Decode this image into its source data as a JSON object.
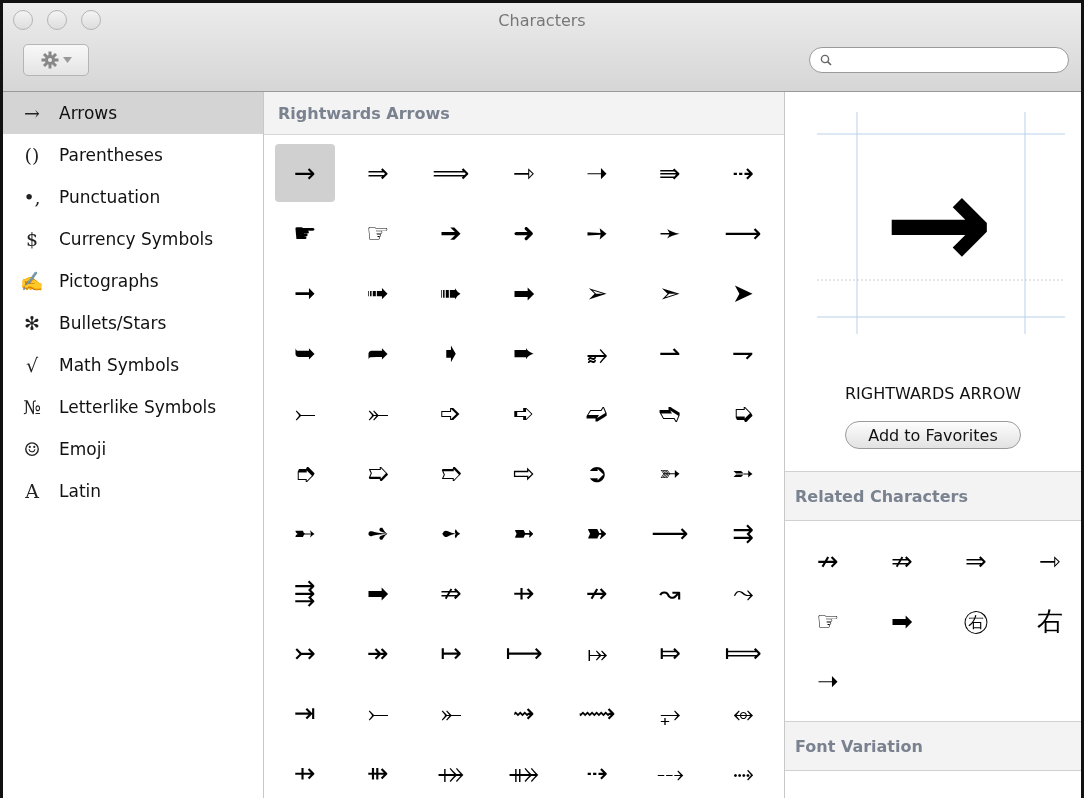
{
  "window": {
    "title": "Characters"
  },
  "sidebar": {
    "items": [
      {
        "symbol": "→",
        "label": "Arrows",
        "selected": true
      },
      {
        "symbol": "()",
        "label": "Parentheses",
        "selected": false
      },
      {
        "symbol": "•,",
        "label": "Punctuation",
        "selected": false
      },
      {
        "symbol": "$",
        "label": "Currency Symbols",
        "selected": false
      },
      {
        "symbol": "✍",
        "label": "Pictographs",
        "selected": false
      },
      {
        "symbol": "✻",
        "label": "Bullets/Stars",
        "selected": false
      },
      {
        "symbol": "√",
        "label": "Math Symbols",
        "selected": false
      },
      {
        "symbol": "№",
        "label": "Letterlike Symbols",
        "selected": false
      },
      {
        "symbol": "☺",
        "label": "Emoji",
        "selected": false
      },
      {
        "symbol": "A",
        "label": "Latin",
        "selected": false
      }
    ]
  },
  "grid": {
    "title": "Rightwards Arrows",
    "rows": [
      [
        {
          "char": "→",
          "selected": true
        },
        {
          "char": "⇒",
          "selected": false
        },
        {
          "char": "⟹",
          "selected": false
        },
        {
          "char": "⇾",
          "selected": false
        },
        {
          "char": "➝",
          "selected": false
        },
        {
          "char": "⇛",
          "selected": false
        },
        {
          "char": "⇢",
          "selected": false
        }
      ],
      [
        {
          "char": "☛",
          "selected": false
        },
        {
          "char": "☞",
          "selected": false
        },
        {
          "char": "➔",
          "selected": false
        },
        {
          "char": "➜",
          "selected": false
        },
        {
          "char": "➙",
          "selected": false
        },
        {
          "char": "➛",
          "selected": false
        },
        {
          "char": "⟶",
          "selected": false
        }
      ],
      [
        {
          "char": "➞",
          "selected": false
        },
        {
          "char": "➟",
          "selected": false
        },
        {
          "char": "➠",
          "selected": false
        },
        {
          "char": "➡",
          "selected": false
        },
        {
          "char": "➢",
          "selected": false
        },
        {
          "char": "➣",
          "selected": false
        },
        {
          "char": "➤",
          "selected": false
        }
      ],
      [
        {
          "char": "➥",
          "selected": false
        },
        {
          "char": "➦",
          "selected": false
        },
        {
          "char": "➧",
          "selected": false
        },
        {
          "char": "➨",
          "selected": false
        },
        {
          "char": "⥵",
          "selected": false
        },
        {
          "char": "⇀",
          "selected": false
        },
        {
          "char": "⇁",
          "selected": false
        }
      ],
      [
        {
          "char": "⤚",
          "selected": false
        },
        {
          "char": "⤜",
          "selected": false
        },
        {
          "char": "➩",
          "selected": false
        },
        {
          "char": "➪",
          "selected": false
        },
        {
          "char": "➫",
          "selected": false
        },
        {
          "char": "➬",
          "selected": false
        },
        {
          "char": "➭",
          "selected": false
        }
      ],
      [
        {
          "char": "➮",
          "selected": false
        },
        {
          "char": "➯",
          "selected": false
        },
        {
          "char": "➱",
          "selected": false
        },
        {
          "char": "⇨",
          "selected": false
        },
        {
          "char": "➲",
          "selected": false
        },
        {
          "char": "➳",
          "selected": false
        },
        {
          "char": "➵",
          "selected": false
        }
      ],
      [
        {
          "char": "➸",
          "selected": false
        },
        {
          "char": "➺",
          "selected": false
        },
        {
          "char": "➻",
          "selected": false
        },
        {
          "char": "➼",
          "selected": false
        },
        {
          "char": "➽",
          "selected": false
        },
        {
          "char": "⟶",
          "selected": false
        },
        {
          "char": "⇉",
          "selected": false
        }
      ],
      [
        {
          "char": "⇶",
          "selected": false
        },
        {
          "char": "➡",
          "selected": false
        },
        {
          "char": "⇏",
          "selected": false
        },
        {
          "char": "⇸",
          "selected": false
        },
        {
          "char": "↛",
          "selected": false
        },
        {
          "char": "↝",
          "selected": false
        },
        {
          "char": "⤳",
          "selected": false
        }
      ],
      [
        {
          "char": "↣",
          "selected": false
        },
        {
          "char": "↠",
          "selected": false
        },
        {
          "char": "↦",
          "selected": false
        },
        {
          "char": "⟼",
          "selected": false
        },
        {
          "char": "⤅",
          "selected": false
        },
        {
          "char": "⤇",
          "selected": false
        },
        {
          "char": "⟾",
          "selected": false
        }
      ],
      [
        {
          "char": "⇥",
          "selected": false
        },
        {
          "char": "⤚",
          "selected": false
        },
        {
          "char": "⤜",
          "selected": false
        },
        {
          "char": "⇝",
          "selected": false
        },
        {
          "char": "⟿",
          "selected": false
        },
        {
          "char": "⥅",
          "selected": false
        },
        {
          "char": "⥈",
          "selected": false
        }
      ],
      [
        {
          "char": "⇸",
          "selected": false
        },
        {
          "char": "⇻",
          "selected": false
        },
        {
          "char": "⤀",
          "selected": false
        },
        {
          "char": "⤁",
          "selected": false
        },
        {
          "char": "⇢",
          "selected": false
        },
        {
          "char": "⤏",
          "selected": false
        },
        {
          "char": "⤑",
          "selected": false
        }
      ]
    ]
  },
  "preview": {
    "glyph": "→",
    "name": "RIGHTWARDS ARROW",
    "button": "Add to Favorites"
  },
  "related": {
    "title": "Related Characters",
    "chars": [
      "↛",
      "⇏",
      "⇒",
      "⇾",
      "☞",
      "➡",
      "㊨",
      "右",
      "➝"
    ]
  },
  "font_variation": {
    "title": "Font Variation"
  }
}
